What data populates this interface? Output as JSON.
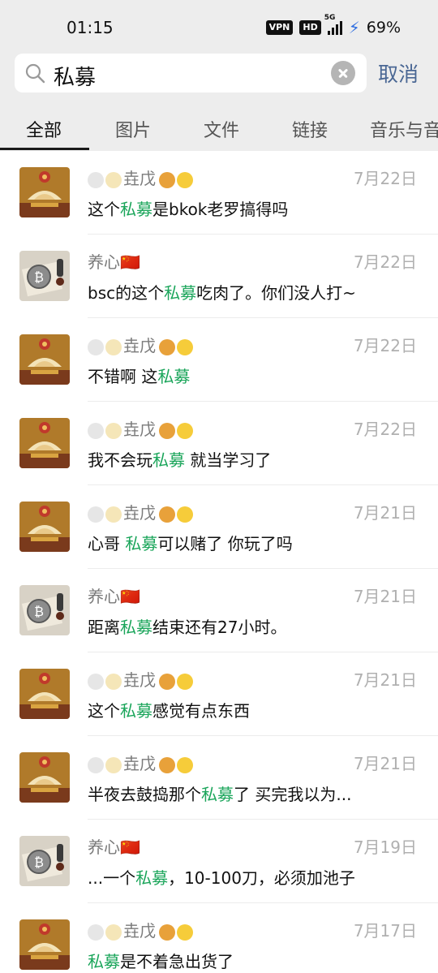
{
  "status": {
    "time": "01:15",
    "vpn": "VPN",
    "hd": "HD",
    "network": "5G",
    "battery": "69%"
  },
  "search": {
    "query": "私募",
    "cancel_label": "取消"
  },
  "tabs": [
    "全部",
    "图片",
    "文件",
    "链接",
    "音乐与音"
  ],
  "active_tab": "全部",
  "colors": {
    "highlight": "#1aa55a",
    "cancel": "#4a6794",
    "header_bg": "#ededed"
  },
  "results": [
    {
      "sender": "垚戊",
      "sender_style": "emoji-name",
      "avatar": "lotus",
      "date": "7月22日",
      "before": "这个",
      "match": "私募",
      "after": "是bkok老罗搞得吗"
    },
    {
      "sender": "养心🇨🇳",
      "sender_style": "plain",
      "avatar": "bitcoin",
      "date": "7月22日",
      "before": "bsc的这个",
      "match": "私募",
      "after": "吃肉了。你们没人打~"
    },
    {
      "sender": "垚戊",
      "sender_style": "emoji-name",
      "avatar": "lotus",
      "date": "7月22日",
      "before": "不错啊 这",
      "match": "私募",
      "after": ""
    },
    {
      "sender": "垚戊",
      "sender_style": "emoji-name",
      "avatar": "lotus",
      "date": "7月22日",
      "before": "我不会玩",
      "match": "私募",
      "after": " 就当学习了"
    },
    {
      "sender": "垚戊",
      "sender_style": "emoji-name",
      "avatar": "lotus",
      "date": "7月21日",
      "before": "心哥 ",
      "match": "私募",
      "after": "可以赌了 你玩了吗"
    },
    {
      "sender": "养心🇨🇳",
      "sender_style": "plain",
      "avatar": "bitcoin",
      "date": "7月21日",
      "before": "距离",
      "match": "私募",
      "after": "结束还有27小时。"
    },
    {
      "sender": "垚戊",
      "sender_style": "emoji-name",
      "avatar": "lotus",
      "date": "7月21日",
      "before": "这个",
      "match": "私募",
      "after": "感觉有点东西"
    },
    {
      "sender": "垚戊",
      "sender_style": "emoji-name",
      "avatar": "lotus",
      "date": "7月21日",
      "before": "半夜去鼓捣那个",
      "match": "私募",
      "after": "了 买完我以为..."
    },
    {
      "sender": "养心🇨🇳",
      "sender_style": "plain",
      "avatar": "bitcoin",
      "date": "7月19日",
      "before": "...一个",
      "match": "私募",
      "after": "，10-100刀，必须加池子"
    },
    {
      "sender": "垚戊",
      "sender_style": "emoji-name",
      "avatar": "lotus",
      "date": "7月17日",
      "before": "",
      "match": "私募",
      "after": "是不着急出货了"
    }
  ]
}
